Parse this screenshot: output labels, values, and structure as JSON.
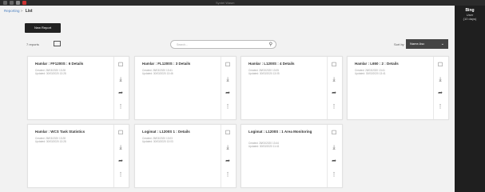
{
  "window": {
    "title": "Syntel Wasm"
  },
  "sidepanel": {
    "name": "Bing",
    "line1": "User",
    "line2": "(10 days)"
  },
  "breadcrumb": {
    "parent": "Reporting",
    "separator": ">",
    "current": "List"
  },
  "new_report_label": "New Report",
  "report_count": "7 reports",
  "search": {
    "placeholder": "Search...",
    "icon": "search-icon"
  },
  "sort": {
    "label": "Sort by",
    "value": "Name Asc",
    "chevron": "⌄"
  },
  "card_actions": {
    "edit": "☐",
    "download": "⤓",
    "share": "➦",
    "more": "⋮"
  },
  "reports": [
    {
      "title": "Hamlar : FF1200S : 6 Details",
      "created": "Created: 28/03/2020 13:28",
      "updated": "Updated: 30/03/2020 13:28"
    },
    {
      "title": "Hamlar : FL1200S : 3 Details",
      "created": "Created: 28/03/2020 13:41",
      "updated": "Updated: 30/03/2020 13:46"
    },
    {
      "title": "Hamlar : L1200S : 4 Details",
      "created": "Created: 28/03/2020 13:05",
      "updated": "Updated: 30/03/2020 13:05"
    },
    {
      "title": "Hamlar : L650 : 2 : Details",
      "created": "Created: 28/03/2020 13:41",
      "updated": "Updated: 30/03/2020 13:41"
    },
    {
      "title": "Hamlar : WCS Task Statistics",
      "created": "Created: 28/03/2020 13:28",
      "updated": "Updated: 30/03/2020 13:28"
    },
    {
      "title": "Logimat : L1200S 1 : Details",
      "created": "Created: 28/03/2020 13:03",
      "updated": "Updated: 30/03/2020 13:03"
    },
    {
      "title": "Logimat : L1200S : 1 Area Monitoring",
      "created": "Created: 28/03/2020 13:44",
      "updated": "Updated: 30/03/2020 11:41"
    }
  ]
}
